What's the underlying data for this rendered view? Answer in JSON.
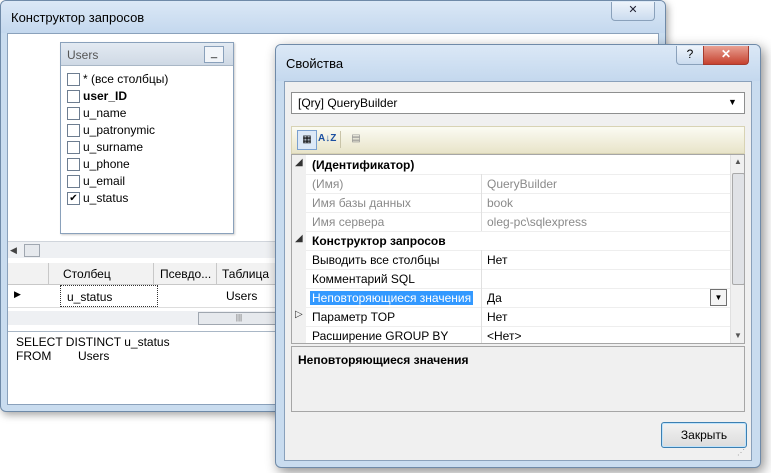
{
  "query_builder": {
    "title": "Конструктор запросов",
    "close_glyph": "✕",
    "table": {
      "name": "Users",
      "minimize_glyph": "_",
      "fields": [
        {
          "label": "* (все столбцы)",
          "checked": false,
          "bold": false
        },
        {
          "label": "user_ID",
          "checked": false,
          "bold": true
        },
        {
          "label": "u_name",
          "checked": false,
          "bold": false
        },
        {
          "label": "u_patronymic",
          "checked": false,
          "bold": false
        },
        {
          "label": "u_surname",
          "checked": false,
          "bold": false
        },
        {
          "label": "u_phone",
          "checked": false,
          "bold": false
        },
        {
          "label": "u_email",
          "checked": false,
          "bold": false
        },
        {
          "label": "u_status",
          "checked": true,
          "bold": false
        }
      ]
    },
    "grid": {
      "headers": [
        "Столбец",
        "Псевдо...",
        "Таблица"
      ],
      "row": {
        "column": "u_status",
        "alias": "",
        "table": "Users"
      },
      "row_marker": "▶",
      "scroll_thumb": "|||"
    },
    "sql": [
      "SELECT DISTINCT u_status",
      "FROM        Users"
    ]
  },
  "properties": {
    "title": "Свойства",
    "help_glyph": "?",
    "close_glyph": "✕",
    "object_select": "[Qry] QueryBuilder",
    "toolbar": {
      "categorized": "▦",
      "alphabetical": "A↓Z",
      "pages": "▤"
    },
    "rows": [
      {
        "expander": "◢",
        "name": "(Идентификатор)",
        "value": "",
        "kind": "cat"
      },
      {
        "expander": "",
        "name": "(Имя)",
        "value": "QueryBuilder",
        "kind": "dim"
      },
      {
        "expander": "",
        "name": "Имя базы данных",
        "value": "book",
        "kind": "dim"
      },
      {
        "expander": "",
        "name": "Имя сервера",
        "value": "oleg-pc\\sqlexpress",
        "kind": "dim"
      },
      {
        "expander": "◢",
        "name": "Конструктор запросов",
        "value": "",
        "kind": "cat"
      },
      {
        "expander": "",
        "name": "Выводить все столбцы",
        "value": "Нет",
        "kind": "normal"
      },
      {
        "expander": "",
        "name": "Комментарий SQL",
        "value": "",
        "kind": "normal"
      },
      {
        "expander": "",
        "name": "Неповторяющиеся значения",
        "value": "Да",
        "kind": "sel"
      },
      {
        "expander": "▷",
        "name": "Параметр TOP",
        "value": "Нет",
        "kind": "normal"
      },
      {
        "expander": "",
        "name": "Расширение GROUP BY",
        "value": "<Нет>",
        "kind": "normal"
      }
    ],
    "description_title": "Неповторяющиеся значения",
    "close_button": "Закрыть"
  }
}
